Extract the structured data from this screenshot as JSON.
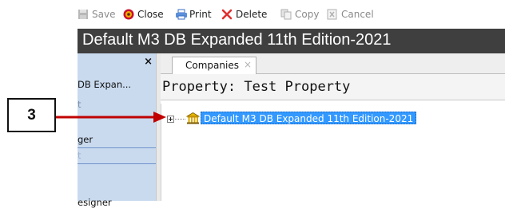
{
  "toolbar": {
    "items": [
      {
        "label": "Save",
        "icon": "save-icon",
        "enabled": false
      },
      {
        "label": "Close",
        "icon": "close-record-icon",
        "enabled": true
      },
      {
        "label": "Print",
        "icon": "print-icon",
        "enabled": true
      },
      {
        "label": "Delete",
        "icon": "delete-icon",
        "enabled": true
      },
      {
        "label": "Copy",
        "icon": "copy-icon",
        "enabled": false
      },
      {
        "label": "Cancel",
        "icon": "cancel-icon",
        "enabled": false
      }
    ]
  },
  "window": {
    "title": "Default M3 DB Expanded 11th Edition-2021"
  },
  "sidebar": {
    "close_glyph": "×",
    "items": [
      {
        "label": "DB Expan..."
      },
      {
        "label": "t"
      },
      {
        "label": "ger"
      },
      {
        "label": "t"
      },
      {
        "label": "esigner"
      }
    ]
  },
  "tabs": [
    {
      "label": "Companies",
      "close_glyph": "×",
      "active": true
    }
  ],
  "property_header": {
    "text": "Property: Test Property"
  },
  "tree": {
    "nodes": [
      {
        "label": "Default M3 DB Expanded 11th Edition-2021",
        "selected": true,
        "expanded": false
      }
    ]
  },
  "annotation": {
    "number": "3"
  },
  "colors": {
    "title_bar": "#3f3f3f",
    "sidebar_bg": "#c9daef",
    "selection": "#3399ff",
    "callout_arrow": "#c00000",
    "delete_x": "#e03030"
  }
}
